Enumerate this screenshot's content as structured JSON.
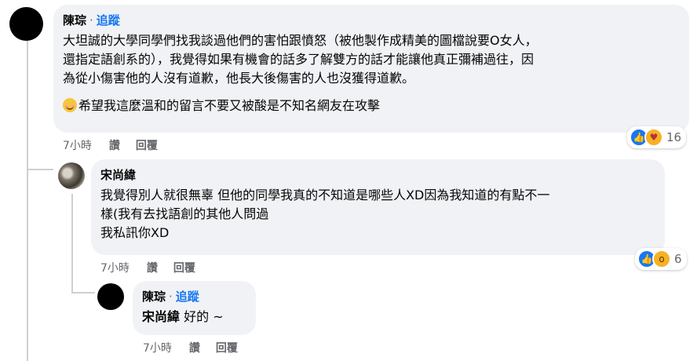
{
  "comment1": {
    "author": "陳琮",
    "follow": "追蹤",
    "lines": [
      "大坦誠的大學同學們找我談過他們的害怕跟憤怒（被他製作成精美的圖檔說要O女人，",
      "還指定語創系的），我覺得如果有機會的話多了解雙方的話才能讓他真正彌補過往，因",
      "為從小傷害他的人沒有道歉，他長大後傷害的人也沒獲得道歉。"
    ],
    "last_line": "希望我這麼溫和的留言不要又被酸是不知名網友在攻擊",
    "emoji": "smiling-blushing-emoji",
    "time": "7小時",
    "like": "讚",
    "reply": "回覆",
    "reaction_count": "16"
  },
  "comment2": {
    "author": "宋尚緯",
    "lines": [
      "我覺得別人就很無辜 但他的同學我真的不知道是哪些人XD因為我知道的有點不一",
      "樣(我有去找語創的其他人問過",
      "我私訊你XD"
    ],
    "time": "7小時",
    "like": "讚",
    "reply": "回覆",
    "reaction_count": "6"
  },
  "comment3": {
    "author": "陳琮",
    "follow": "追蹤",
    "mention": "宋尚緯",
    "text": "好的 ~",
    "time": "7小時",
    "like": "讚",
    "reply": "回覆"
  },
  "colors": {
    "link": "#1877f2",
    "bubble": "#f0f2f5",
    "meta": "#65676b"
  }
}
